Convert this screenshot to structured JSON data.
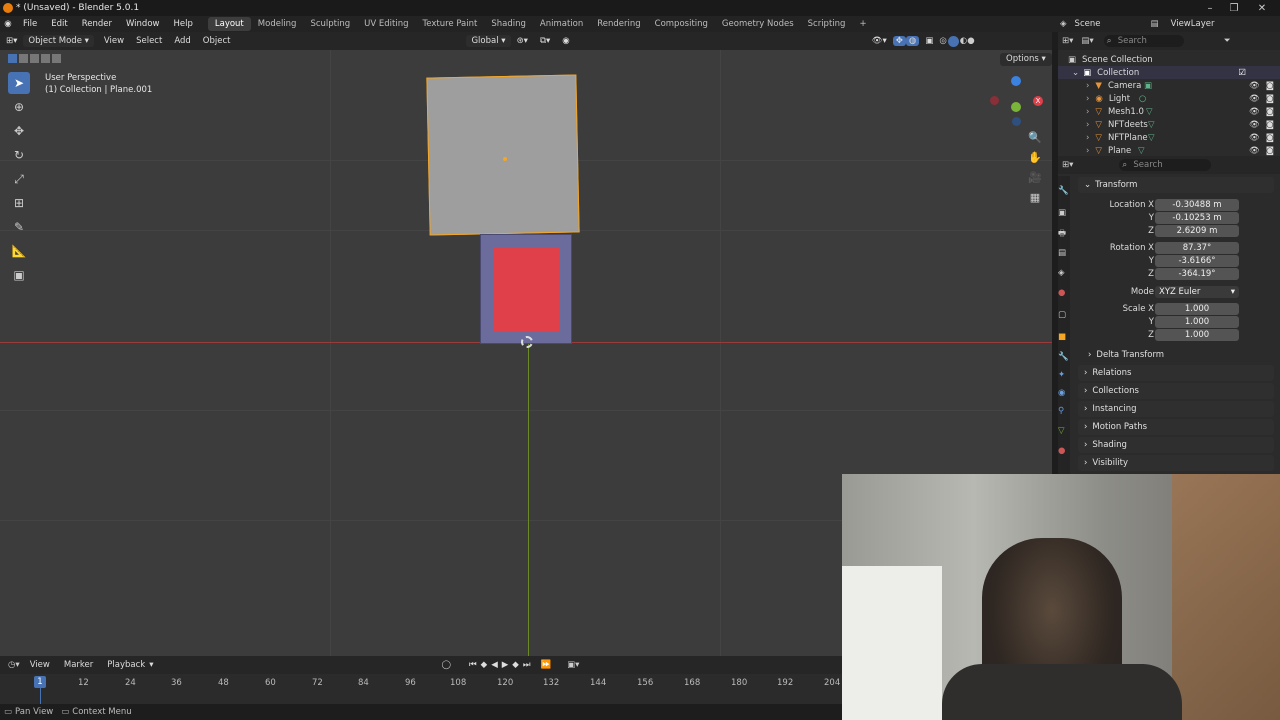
{
  "window": {
    "title": "* (Unsaved) - Blender 5.0.1"
  },
  "menu": {
    "items": [
      "File",
      "Edit",
      "Render",
      "Window",
      "Help"
    ]
  },
  "workspaces": {
    "tabs": [
      "Layout",
      "Modeling",
      "Sculpting",
      "UV Editing",
      "Texture Paint",
      "Shading",
      "Animation",
      "Rendering",
      "Compositing",
      "Geometry Nodes",
      "Scripting"
    ],
    "active": "Layout",
    "add": "+"
  },
  "scene": {
    "label": "Scene",
    "view_layer": "ViewLayer"
  },
  "viewport_header": {
    "mode": "Object Mode",
    "menus": [
      "View",
      "Select",
      "Add",
      "Object"
    ],
    "orientation": "Global",
    "options": "Options"
  },
  "viewport": {
    "perspective": "User Perspective",
    "context": "(1) Collection | Plane.001"
  },
  "outliner": {
    "search_placeholder": "Search",
    "root": "Scene Collection",
    "collection": "Collection",
    "items": [
      "Camera",
      "Light",
      "Mesh1.0",
      "NFTdeets",
      "NFTPlane",
      "Plane"
    ]
  },
  "properties": {
    "search_placeholder": "Search",
    "panel": "Transform",
    "location": {
      "label": "Location X",
      "x": "-0.30488 m",
      "y": "-0.10253 m",
      "z": "2.6209 m"
    },
    "rotation": {
      "label": "Rotation X",
      "x": "87.37°",
      "y": "-3.6166°",
      "z": "-364.19°"
    },
    "mode": {
      "label": "Mode",
      "value": "XYZ Euler"
    },
    "scale": {
      "label": "Scale X",
      "x": "1.000",
      "y": "1.000",
      "z": "1.000"
    },
    "axis": {
      "y": "Y",
      "z": "Z"
    },
    "delta": "Delta Transform",
    "sections": [
      "Relations",
      "Collections",
      "Instancing",
      "Motion Paths",
      "Shading",
      "Visibility"
    ]
  },
  "timeline": {
    "menus": [
      "View",
      "Marker",
      "Playback"
    ],
    "current_frame": "1",
    "ticks": [
      "12",
      "24",
      "36",
      "48",
      "60",
      "72",
      "84",
      "96",
      "108",
      "120",
      "132",
      "144",
      "156",
      "168",
      "180",
      "192",
      "204"
    ]
  },
  "statusbar": {
    "pan": "Pan View",
    "context": "Context Menu"
  },
  "colors": {
    "accent": "#4772b3",
    "selected": "#f5a623",
    "red_panel": "#e0404a",
    "frame": "#6b6b9c"
  }
}
